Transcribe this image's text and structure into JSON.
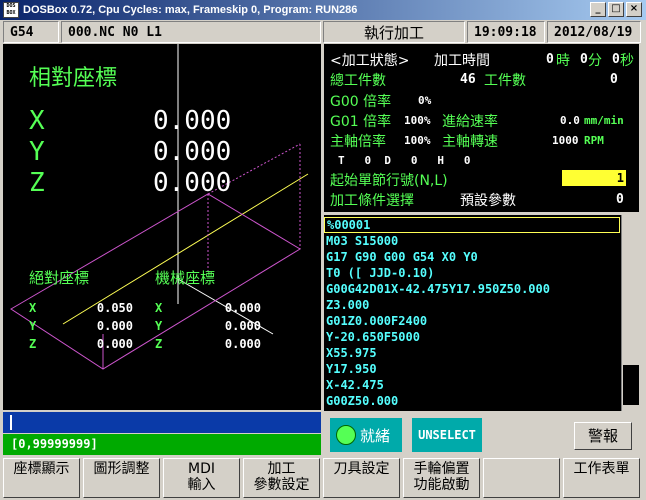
{
  "window": {
    "title": "DOSBox 0.72, Cpu Cycles:     max, Frameskip  0, Program:   RUN286",
    "icon_text": "DOS BOX",
    "buttons": [
      "_",
      "□",
      "×"
    ]
  },
  "header": {
    "coord_system": "G54",
    "program": "000.NC N0 L1",
    "mode": "執行加工",
    "time": "19:09:18",
    "date": "2012/08/19"
  },
  "coords": {
    "title": "相對座標",
    "axes": [
      {
        "label": "X",
        "value": "0.000"
      },
      {
        "label": "Y",
        "value": "0.000"
      },
      {
        "label": "Z",
        "value": "0.000"
      }
    ],
    "absolute": {
      "title": "絕對座標",
      "rows": [
        {
          "label": "X",
          "value": "0.050"
        },
        {
          "label": "Y",
          "value": "0.000"
        },
        {
          "label": "Z",
          "value": "0.000"
        }
      ]
    },
    "machine": {
      "title": "機械座標",
      "rows": [
        {
          "label": "X",
          "value": "0.000"
        },
        {
          "label": "Y",
          "value": "0.000"
        },
        {
          "label": "Z",
          "value": "0.000"
        }
      ]
    }
  },
  "status": {
    "state_label": "<加工狀態>",
    "time_label": "加工時間",
    "time_h": "0",
    "time_h_unit": "時",
    "time_m": "0",
    "time_m_unit": "分",
    "time_s": "0",
    "time_s_unit": "秒",
    "total_label": "總工件數",
    "total_value": "46",
    "count_label": "工件數",
    "count_value": "0",
    "g00_label": "G00 倍率",
    "g00_value": "0%",
    "g01_label": "G01 倍率",
    "g01_value": "100%",
    "feed_label": "進給速率",
    "feed_value": "0.0",
    "feed_unit": "mm/min",
    "spindle_rate_label": "主軸倍率",
    "spindle_rate_value": "100%",
    "spindle_speed_label": "主軸轉速",
    "spindle_speed_value": "1000",
    "spindle_unit": "RPM",
    "tdh": "T   0  D   0   H   0",
    "start_label": "起始單節行號(N,L)",
    "start_value": "1",
    "cond_label": "加工條件選擇",
    "cond_name": "預設參數",
    "cond_value": "0"
  },
  "program": {
    "lines": [
      "%00001",
      "M03 S15000",
      "G17 G90 G00 G54 X0 Y0",
      "T0 ([  JJD-0.10)",
      "G00G42D01X-42.475Y17.950Z50.000",
      "Z3.000",
      "G01Z0.000F2400",
      "Y-20.650F5000",
      "X55.975",
      "Y17.950",
      "X-42.475",
      "G00Z50.000"
    ]
  },
  "input": {
    "value": "",
    "range": "[0,99999999]"
  },
  "buttons": {
    "ready": "就緒",
    "unselect": "UNSELECT",
    "alarm": "警報"
  },
  "fkeys": [
    {
      "line1": "座標顯示",
      "line2": ""
    },
    {
      "line1": "圖形調整",
      "line2": ""
    },
    {
      "line1": "MDI",
      "line2": "輸入"
    },
    {
      "line1": "加工",
      "line2": "參數設定"
    },
    {
      "line1": "刀具設定",
      "line2": ""
    },
    {
      "line1": "手輪偏置",
      "line2": "功能啟動"
    },
    {
      "line1": "",
      "line2": ""
    },
    {
      "line1": "工作表單",
      "line2": ""
    }
  ],
  "colors": {
    "screen_bg": "#000000",
    "label_green": "#55ff55",
    "value_white": "#ffffff",
    "program_cyan": "#55ffff",
    "highlight_yellow": "#ffff33",
    "button_teal": "#00aaaa"
  }
}
